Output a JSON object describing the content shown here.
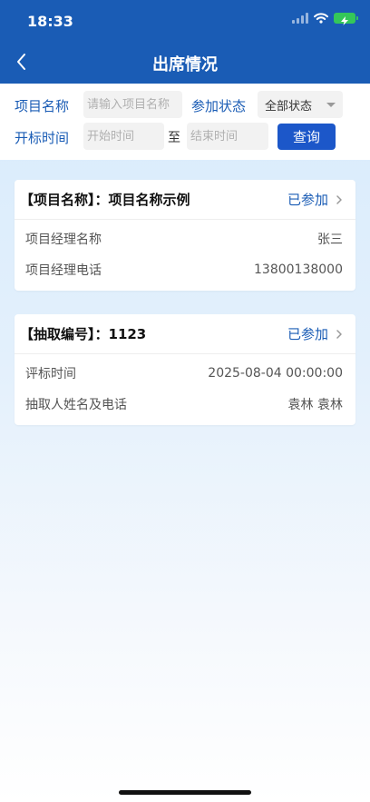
{
  "status_bar": {
    "time": "18:33",
    "icons": [
      "signal-icon",
      "wifi-icon",
      "battery-charging-icon"
    ]
  },
  "nav": {
    "title": "出席情况",
    "back_icon": "chevron-left-icon"
  },
  "filters": {
    "project_name_label": "项目名称",
    "project_name_placeholder": "请输入项目名称",
    "status_label": "参加状态",
    "status_selected": "全部状态",
    "bid_time_label": "开标时间",
    "start_time_placeholder": "开始时间",
    "to_label": "至",
    "end_time_placeholder": "结束时间",
    "query_button": "查询"
  },
  "cards": [
    {
      "title": "【项目名称】：项目名称示例",
      "status": "已参加",
      "rows": [
        {
          "label": "项目经理名称",
          "value": "张三"
        },
        {
          "label": "项目经理电话",
          "value": "13800138000"
        }
      ]
    },
    {
      "title": "【抽取编号】：1123",
      "status": "已参加",
      "rows": [
        {
          "label": "评标时间",
          "value": "2025-08-04 00:00:00"
        },
        {
          "label": "抽取人姓名及电话",
          "value": "袁林 袁林"
        }
      ]
    }
  ],
  "colors": {
    "header_bg": "#1a5cb5",
    "accent_blue": "#1a5cb5",
    "button_bg": "#1c57c9",
    "battery_green": "#34c759",
    "page_bg_top": "#d6eafb"
  }
}
